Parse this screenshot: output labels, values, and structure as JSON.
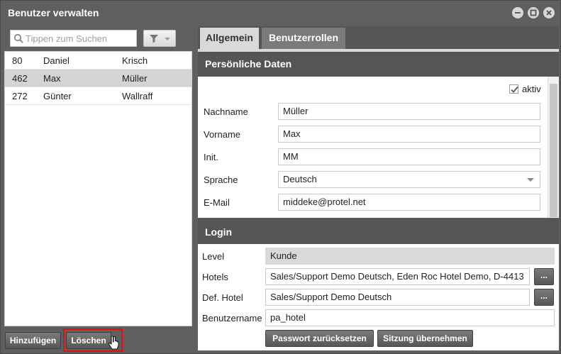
{
  "window": {
    "title": "Benutzer verwalten"
  },
  "search": {
    "placeholder": "Tippen zum Suchen"
  },
  "users": [
    {
      "id": "80",
      "first": "Daniel",
      "last": "Krisch",
      "selected": false
    },
    {
      "id": "462",
      "first": "Max",
      "last": "Müller",
      "selected": true
    },
    {
      "id": "272",
      "first": "Günter",
      "last": "Wallraff",
      "selected": false
    }
  ],
  "buttons": {
    "add": "Hinzufügen",
    "delete": "Löschen"
  },
  "tabs": {
    "general": "Allgemein",
    "roles": "Benutzerrollen"
  },
  "personal": {
    "header": "Persönliche Daten",
    "active_label": "aktiv",
    "active": true,
    "lastname_label": "Nachname",
    "lastname": "Müller",
    "firstname_label": "Vorname",
    "firstname": "Max",
    "init_label": "Init.",
    "init": "MM",
    "language_label": "Sprache",
    "language": "Deutsch",
    "email_label": "E-Mail",
    "email": "middeke@protel.net"
  },
  "login": {
    "header": "Login",
    "level_label": "Level",
    "level": "Kunde",
    "hotels_label": "Hotels",
    "hotels": "Sales/Support Demo Deutsch, Eden Roc Hotel Demo, D-4413",
    "def_hotel_label": "Def. Hotel",
    "def_hotel": "Sales/Support Demo Deutsch",
    "username_label": "Benutzername",
    "username": "pa_hotel",
    "reset_password": "Passwort zurücksetzen",
    "take_session": "Sitzung übernehmen",
    "browse": "..."
  }
}
